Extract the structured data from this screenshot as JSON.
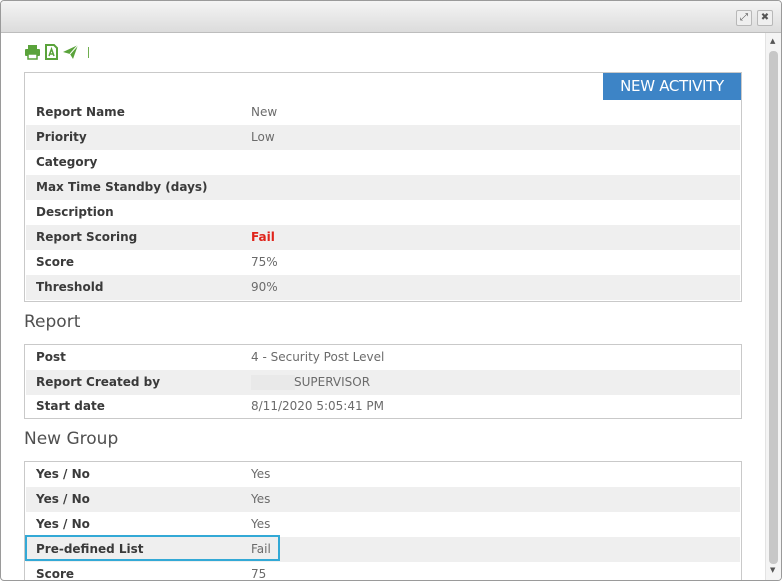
{
  "titlebar": {
    "maximize_icon": "maximize-icon",
    "close_icon": "close-icon"
  },
  "toolbar": {
    "icons": [
      "print-icon",
      "pdf-icon",
      "send-icon"
    ],
    "accent_color": "#5aa33b"
  },
  "activity": {
    "button_label": "NEW ACTIVITY",
    "button_color": "#3d84c6",
    "rows": [
      {
        "label": "Report Name",
        "value": "New"
      },
      {
        "label": "Priority",
        "value": "Low"
      },
      {
        "label": "Category",
        "value": ""
      },
      {
        "label": "Max Time Standby (days)",
        "value": ""
      },
      {
        "label": "Description",
        "value": ""
      },
      {
        "label": "Report Scoring",
        "value": "Fail"
      },
      {
        "label": "Score",
        "value": "75%"
      },
      {
        "label": "Threshold",
        "value": "90%"
      }
    ]
  },
  "report": {
    "title": "Report",
    "rows": [
      {
        "label": "Post",
        "value": "4 - Security Post Level"
      },
      {
        "label": "Report Created by",
        "value": "SUPERVISOR"
      },
      {
        "label": "Start date",
        "value": "8/11/2020 5:05:41 PM"
      }
    ]
  },
  "group": {
    "title": "New Group",
    "rows": [
      {
        "label": "Yes / No",
        "value": "Yes"
      },
      {
        "label": "Yes / No",
        "value": "Yes"
      },
      {
        "label": "Yes / No",
        "value": "Yes"
      },
      {
        "label": "Pre-defined List",
        "value": "Fail"
      },
      {
        "label": "Score",
        "value": "75"
      }
    ]
  },
  "colors": {
    "fail": "#e0241b",
    "highlight": "#33a9d6"
  }
}
